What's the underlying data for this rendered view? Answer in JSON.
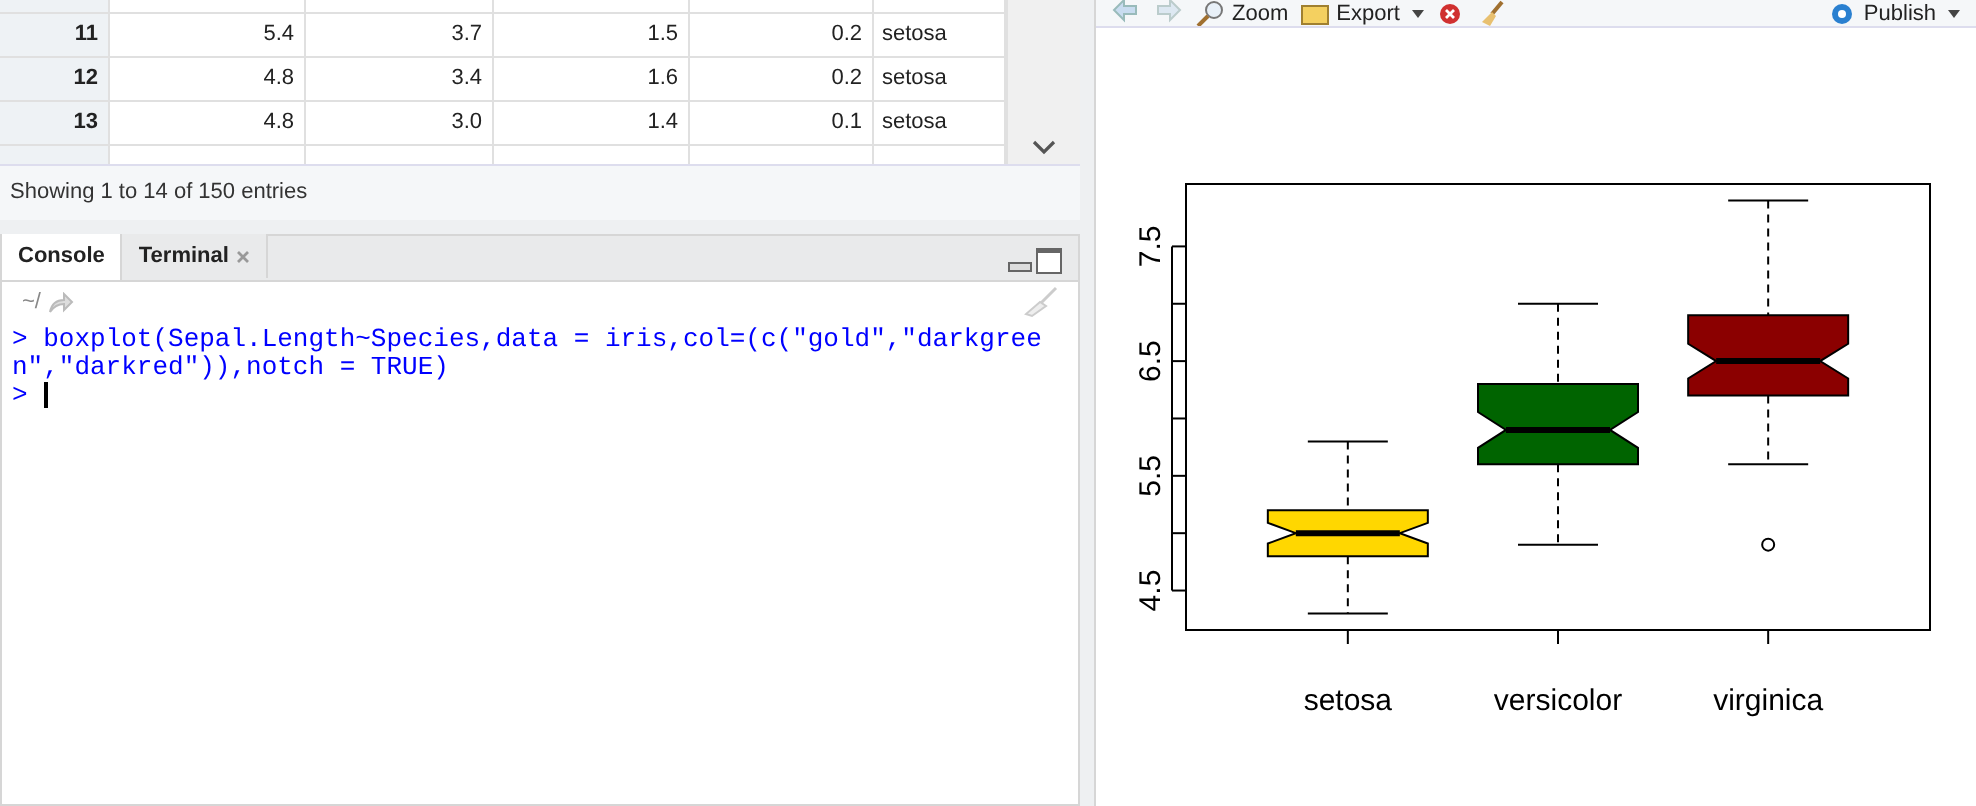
{
  "data_table": {
    "rows": [
      {
        "row": "11",
        "cells": [
          "5.4",
          "3.7",
          "1.5",
          "0.2",
          "setosa"
        ]
      },
      {
        "row": "12",
        "cells": [
          "4.8",
          "3.4",
          "1.6",
          "0.2",
          "setosa"
        ]
      },
      {
        "row": "13",
        "cells": [
          "4.8",
          "3.0",
          "1.4",
          "0.1",
          "setosa"
        ]
      }
    ],
    "footer": "Showing 1 to 14 of 150 entries"
  },
  "console": {
    "tabs": [
      {
        "label": "Console",
        "selected": true,
        "closable": false
      },
      {
        "label": "Terminal",
        "selected": false,
        "closable": true
      }
    ],
    "path": "~/",
    "lines": [
      {
        "prompt": ">",
        "text": "boxplot(Sepal.Length~Species,data = iris,col=(c(\"gold\",\"darkgreen\",\"darkred\")),notch = TRUE)"
      },
      {
        "prompt": ">"
      }
    ]
  },
  "plots_toolbar": {
    "buttons": [
      {
        "kind": "back"
      },
      {
        "kind": "forward"
      },
      {
        "kind": "zoom",
        "label": "Zoom"
      },
      {
        "kind": "export",
        "label": "Export"
      },
      {
        "kind": "remove"
      },
      {
        "kind": "clear"
      },
      {
        "kind": "publish",
        "label": "Publish"
      }
    ]
  },
  "plot": {
    "y_tick_labels": [
      "4.5",
      "5.5",
      "6.5",
      "7.5"
    ],
    "groups": [
      {
        "name": "setosa",
        "color": "#ffd700"
      },
      {
        "name": "versicolor",
        "color": "#006400"
      },
      {
        "name": "virginica",
        "color": "#8b0000"
      }
    ]
  }
}
